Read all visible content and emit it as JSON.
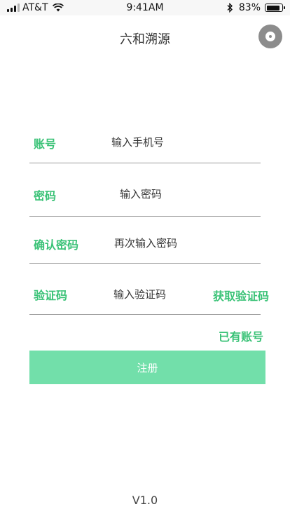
{
  "status_bar": {
    "carrier": "AT&T",
    "time": "9:41AM",
    "battery_percent": "83%",
    "battery_level": 0.83,
    "signal_bars_filled": 3,
    "signal_bars_total": 4
  },
  "header": {
    "title": "六和溯源",
    "menu_icon": "more-circle-icon"
  },
  "form": {
    "account": {
      "label": "账号",
      "placeholder": "输入手机号",
      "value": ""
    },
    "password": {
      "label": "密码",
      "placeholder": "输入密码",
      "value": ""
    },
    "confirm_password": {
      "label": "确认密码",
      "placeholder": "再次输入密码",
      "value": ""
    },
    "code": {
      "label": "验证码",
      "placeholder": "输入验证码",
      "value": "",
      "get_code_label": "获取验证码"
    }
  },
  "links": {
    "have_account": "已有账号"
  },
  "register_button": "注册",
  "footer": {
    "version": "V1.0"
  },
  "colors": {
    "accent": "#39c276",
    "button_bg": "#72dfaa",
    "divider": "#9a9a9a"
  }
}
